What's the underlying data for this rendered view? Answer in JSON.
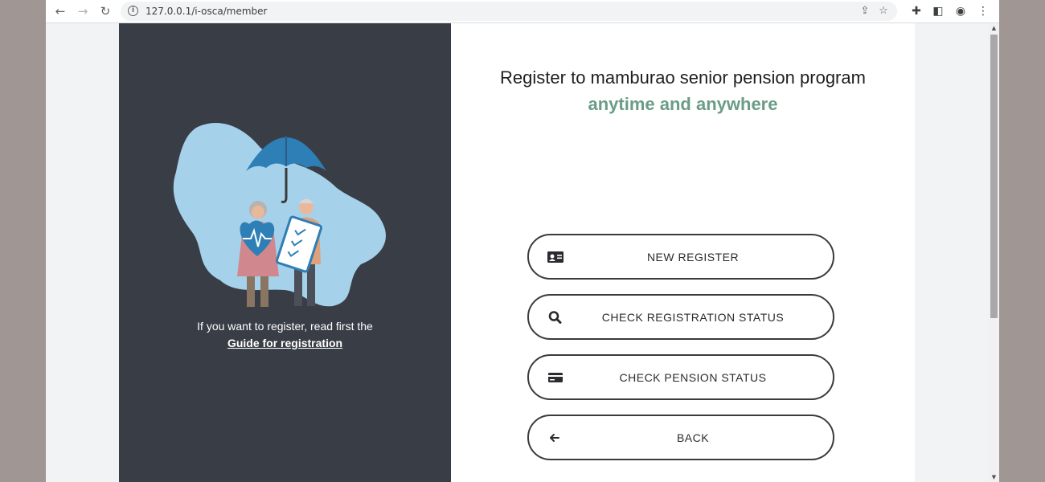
{
  "browser": {
    "url": "127.0.0.1/i-osca/member"
  },
  "page": {
    "heading": "Register to mamburao senior pension program",
    "subheading": "anytime and anywhere",
    "guide_text": "If you want to register, read first the",
    "guide_link": "Guide for registration",
    "buttons": [
      {
        "label": "NEW REGISTER",
        "icon": "id-card-icon"
      },
      {
        "label": "CHECK REGISTRATION STATUS",
        "icon": "search-icon"
      },
      {
        "label": "CHECK PENSION STATUS",
        "icon": "credit-card-icon"
      },
      {
        "label": "BACK",
        "icon": "arrow-left-icon"
      }
    ]
  },
  "colors": {
    "left_panel": "#393d46",
    "accent_green": "#6a9c87",
    "page_background": "#a09694"
  }
}
